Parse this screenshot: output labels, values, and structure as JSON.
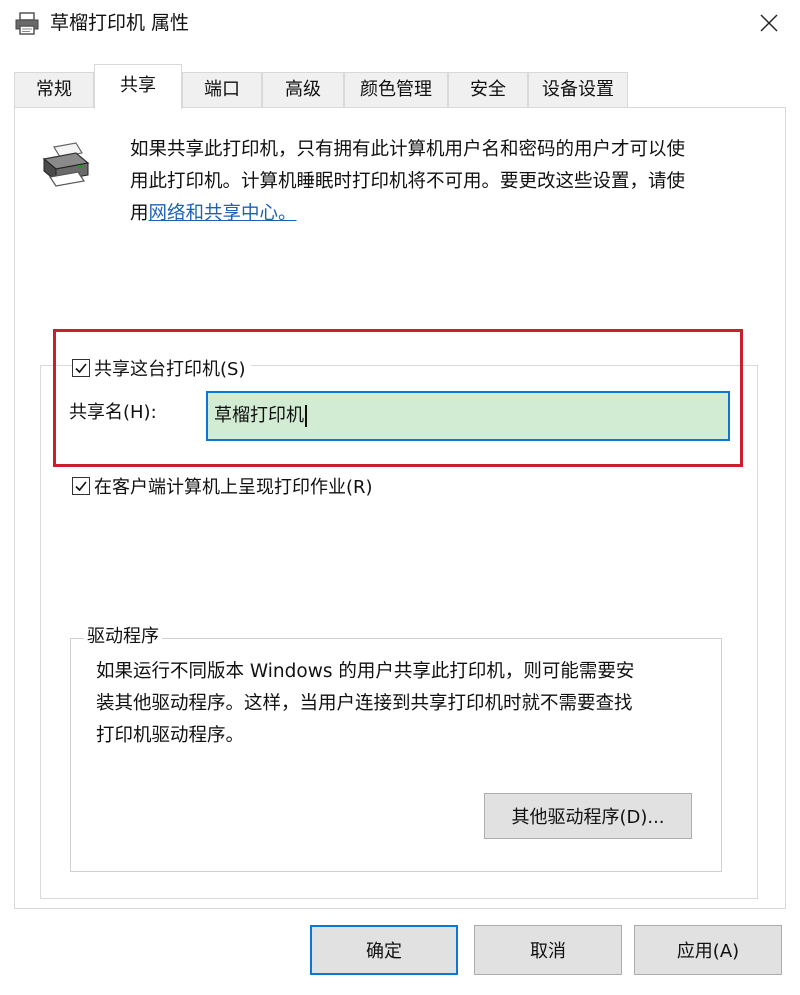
{
  "window": {
    "title": "草榴打印机 属性",
    "icon": "printer-icon",
    "close_icon": "close-icon"
  },
  "tabs": [
    {
      "label": "常规",
      "active": false
    },
    {
      "label": "共享",
      "active": true
    },
    {
      "label": "端口",
      "active": false
    },
    {
      "label": "高级",
      "active": false
    },
    {
      "label": "颜色管理",
      "active": false
    },
    {
      "label": "安全",
      "active": false
    },
    {
      "label": "设备设置",
      "active": false
    }
  ],
  "sharing": {
    "intro_lines": [
      "如果共享此打印机，只有拥有此计算机用户名和密码的用户才可以使",
      "用此打印机。计算机睡眠时打印机将不可用。要更改这些设置，请使"
    ],
    "intro_prefix": "用",
    "intro_link": "网络和共享中心。",
    "share_checkbox_label": "共享这台打印机(S)",
    "share_checked": true,
    "share_name_label": "共享名(H):",
    "share_name_value": "草榴打印机",
    "render_checkbox_label": "在客户端计算机上呈现打印作业(R)",
    "render_checked": true,
    "highlight_color": "#c8202f"
  },
  "drivers": {
    "legend": "驱动程序",
    "text_lines": [
      "如果运行不同版本 Windows 的用户共享此打印机，则可能需要安",
      "装其他驱动程序。这样，当用户连接到共享打印机时就不需要查找",
      "打印机驱动程序。"
    ],
    "button_label": "其他驱动程序(D)..."
  },
  "footer": {
    "ok_label": "确定",
    "cancel_label": "取消",
    "apply_label": "应用(A)"
  },
  "colors": {
    "accent": "#0a78d4",
    "link": "#1f62b5",
    "input_bg": "#d2ecd3"
  }
}
